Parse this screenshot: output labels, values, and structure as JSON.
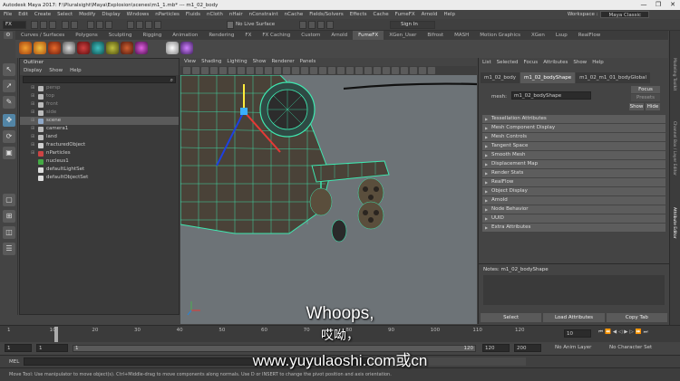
{
  "window": {
    "title": "Autodesk Maya 2017: F:\\Pluralsight\\Maya\\Explosion\\scenes\\m1_1.mb* --- m1_02_body",
    "controls": [
      "—",
      "❐",
      "✕"
    ]
  },
  "menubar": {
    "items": [
      "File",
      "Edit",
      "Create",
      "Select",
      "Modify",
      "Display",
      "Windows",
      "nParticles",
      "Fluids",
      "nCloth",
      "nHair",
      "nConstraint",
      "nCache",
      "Fields/Solvers",
      "Effects",
      "Cache",
      "FumeFX",
      "Arnold",
      "Help"
    ],
    "workspace_label": "Workspace :",
    "workspace_value": "Maya Classic"
  },
  "statusline": {
    "mode": "FX",
    "no_live_surface": "No Live Surface",
    "sign_in": "Sign In"
  },
  "shelf": {
    "tabs": [
      "Curves / Surfaces",
      "Polygons",
      "Sculpting",
      "Rigging",
      "Animation",
      "Rendering",
      "FX",
      "FX Caching",
      "Custom",
      "Arnold",
      "FumeFX",
      "XGen_User",
      "Bifrost",
      "MASH",
      "Motion Graphics",
      "XGen",
      "Lsup",
      "RealFlow"
    ],
    "active_tab": "FumeFX"
  },
  "outliner": {
    "title": "Outliner",
    "menu": [
      "Display",
      "Show",
      "Help"
    ],
    "items": [
      {
        "label": "persp",
        "expandable": true,
        "icon_color": "#bbbbbb",
        "dim": true
      },
      {
        "label": "top",
        "expandable": true,
        "icon_color": "#bbbbbb",
        "dim": true
      },
      {
        "label": "front",
        "expandable": true,
        "icon_color": "#bbbbbb",
        "dim": true
      },
      {
        "label": "side",
        "expandable": true,
        "icon_color": "#bbbbbb",
        "dim": true
      },
      {
        "label": "scene",
        "expandable": true,
        "icon_color": "#8fa8c8",
        "highlight": true
      },
      {
        "label": "camera1",
        "expandable": true,
        "icon_color": "#bbbbbb"
      },
      {
        "label": "land",
        "expandable": true,
        "icon_color": "#bbbbbb"
      },
      {
        "label": "fracturedObject",
        "expandable": true,
        "icon_color": "#d0d0d0"
      },
      {
        "label": "nParticles",
        "expandable": true,
        "icon_color": "#cc4444"
      },
      {
        "label": "nucleus1",
        "expandable": false,
        "icon_color": "#44aa44"
      },
      {
        "label": "defaultLightSet",
        "expandable": false,
        "icon_color": "#dddddd"
      },
      {
        "label": "defaultObjectSet",
        "expandable": false,
        "icon_color": "#dddddd"
      }
    ]
  },
  "viewport": {
    "menu": [
      "View",
      "Shading",
      "Lighting",
      "Show",
      "Renderer",
      "Panels"
    ],
    "colors": {
      "wire": "#3ee8b0",
      "ground": "#6d7377",
      "metal": "#4a4238"
    }
  },
  "attribute_editor": {
    "menu": [
      "List",
      "Selected",
      "Focus",
      "Attributes",
      "Show",
      "Help"
    ],
    "tabs": [
      "m1_02_body",
      "m1_02_bodyShape",
      "m1_02_m1_01_bodyGlobal"
    ],
    "active_tab": "m1_02_bodyShape",
    "mesh_label": "mesh:",
    "mesh_value": "m1_02_bodyShape",
    "focus": "Focus",
    "presets": "Presets",
    "show": "Show",
    "hide": "Hide",
    "sections": [
      "Tessellation Attributes",
      "Mesh Component Display",
      "Mesh Controls",
      "Tangent Space",
      "Smooth Mesh",
      "Displacement Map",
      "Render Stats",
      "RealFlow",
      "Object Display",
      "Arnold",
      "Node Behavior",
      "UUID",
      "Extra Attributes"
    ],
    "notes_label": "Notes: m1_02_bodyShape",
    "buttons": [
      "Select",
      "Load Attributes",
      "Copy Tab"
    ]
  },
  "right_strip": {
    "tabs": [
      "Modeling Toolkit",
      "Channel Box / Layer Editor",
      "Attribute Editor"
    ]
  },
  "timeline": {
    "current_frame": "10",
    "ticks": [
      "1",
      "10",
      "20",
      "30",
      "40",
      "50",
      "60",
      "70",
      "80",
      "90",
      "100",
      "110",
      "120"
    ],
    "start": "1",
    "range_start": "1",
    "range_end": "120",
    "end": "200",
    "anim_layer": "No Anim Layer",
    "char_set": "No Character Set",
    "range_label": "120"
  },
  "cmdline": {
    "lang": "MEL"
  },
  "helpline": {
    "text": "Move Tool: Use manipulator to move object(s). Ctrl+Middle-drag to move components along normals. Use D or INSERT to change the pivot position and axis orientation."
  },
  "subtitles": {
    "line1": "Whoops,",
    "line2": "哎呦，",
    "line3": "www.yuyulaoshi.com或cn"
  }
}
